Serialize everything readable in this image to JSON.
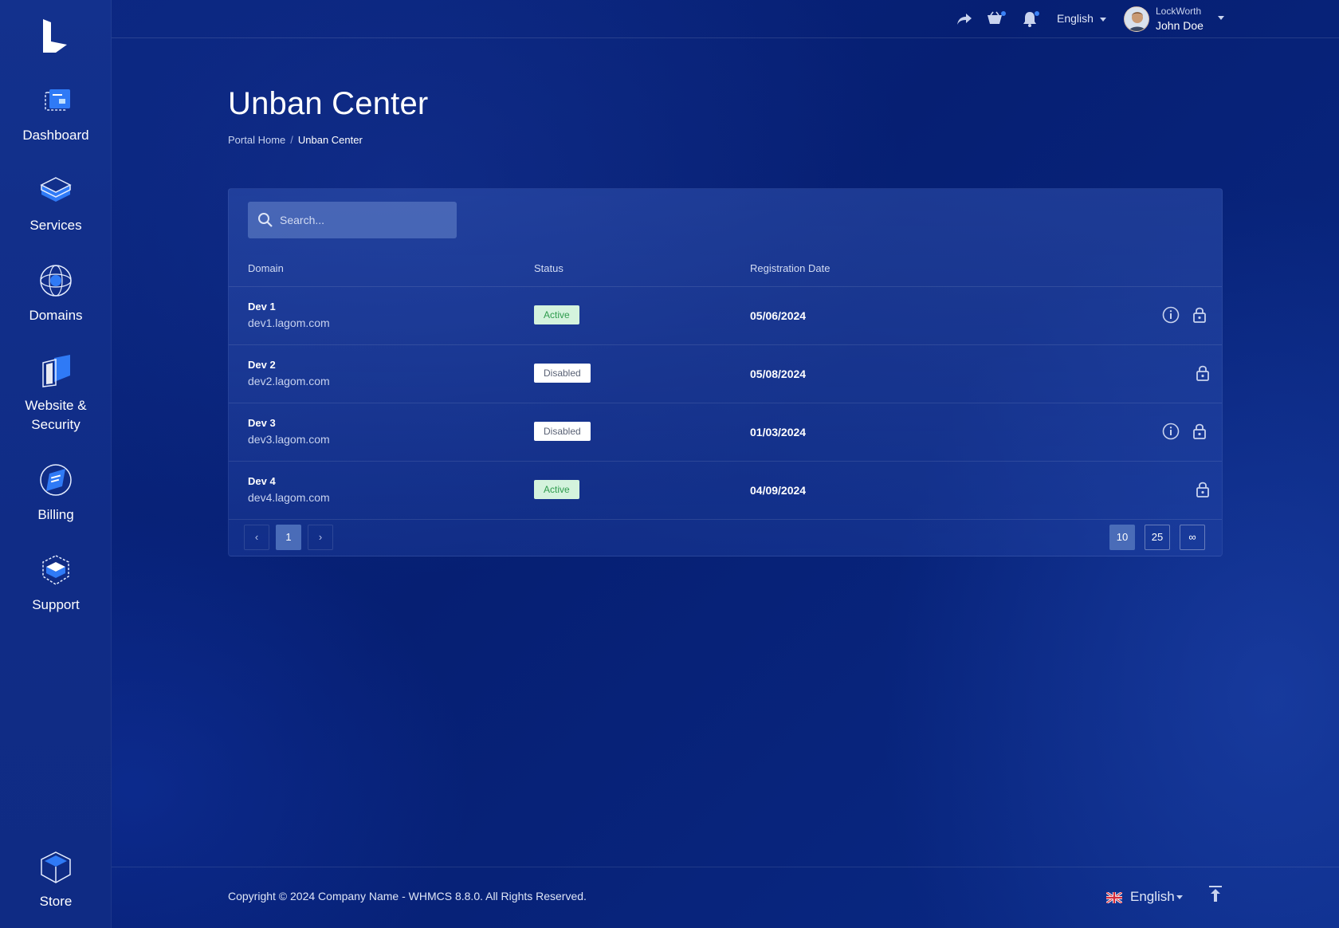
{
  "sidebar": {
    "items": [
      {
        "label": "Dashboard",
        "icon": "dashboard-icon"
      },
      {
        "label": "Services",
        "icon": "services-icon"
      },
      {
        "label": "Domains",
        "icon": "domains-icon"
      },
      {
        "label": "Website & Security",
        "label_line1": "Website &",
        "label_line2": "Security",
        "icon": "website-security-icon"
      },
      {
        "label": "Billing",
        "icon": "billing-icon"
      },
      {
        "label": "Support",
        "icon": "support-icon"
      },
      {
        "label": "Store",
        "icon": "store-icon"
      }
    ]
  },
  "topbar": {
    "language": "English",
    "user_company": "LockWorth",
    "user_name": "John Doe"
  },
  "page": {
    "title": "Unban Center",
    "breadcrumb": {
      "home": "Portal Home",
      "separator": "/",
      "current": "Unban Center"
    }
  },
  "table": {
    "search_placeholder": "Search...",
    "headers": {
      "domain": "Domain",
      "status": "Status",
      "date": "Registration Date"
    },
    "rows": [
      {
        "name": "Dev 1",
        "host": "dev1.lagom.com",
        "status": "Active",
        "date": "05/06/2024",
        "has_info": true
      },
      {
        "name": "Dev 2",
        "host": "dev2.lagom.com",
        "status": "Disabled",
        "date": "05/08/2024",
        "has_info": false
      },
      {
        "name": "Dev 3",
        "host": "dev3.lagom.com",
        "status": "Disabled",
        "date": "01/03/2024",
        "has_info": true
      },
      {
        "name": "Dev 4",
        "host": "dev4.lagom.com",
        "status": "Active",
        "date": "04/09/2024",
        "has_info": false
      }
    ],
    "pagination": {
      "prev": "‹",
      "current_page": "1",
      "next": "›"
    },
    "page_sizes": [
      "10",
      "25",
      "∞"
    ],
    "selected_page_size": "10"
  },
  "footer": {
    "copyright": "Copyright © 2024 Company Name - WHMCS 8.8.0. All Rights Reserved.",
    "language": "English"
  },
  "colors": {
    "background": "#07227a",
    "sidebar": "#13318d",
    "accent": "#3b82f6",
    "active_badge": "#d4f3dd",
    "active_text": "#2e9b4d"
  }
}
